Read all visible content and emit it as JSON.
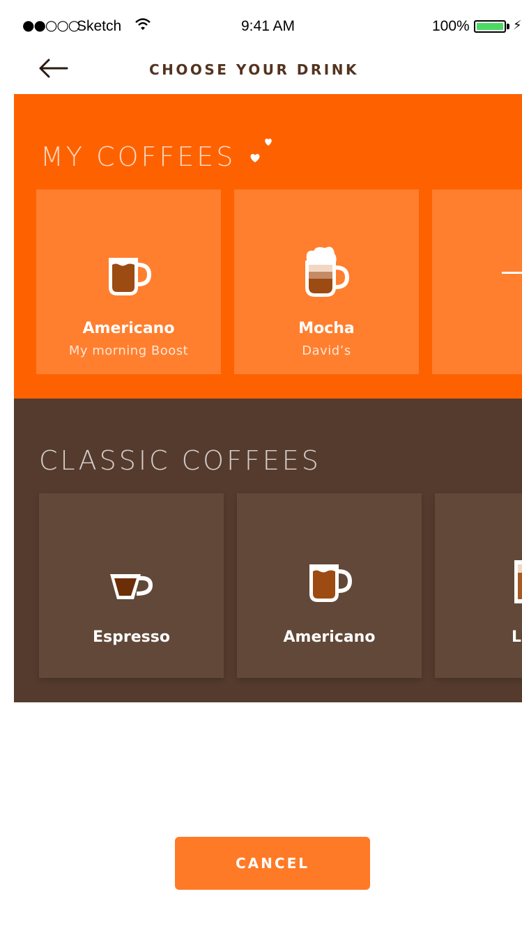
{
  "status_bar": {
    "signal": "●●○○○",
    "carrier": "Sketch",
    "time": "9:41 AM",
    "battery_percent": "100%"
  },
  "nav": {
    "title": "CHOOSE YOUR DRINK"
  },
  "my_coffees": {
    "title": "MY COFFEES",
    "cards": [
      {
        "name": "Americano",
        "subtitle": "My morning Boost",
        "icon": "americano-mug-icon"
      },
      {
        "name": "Mocha",
        "subtitle": "David’s",
        "icon": "mocha-mug-icon"
      }
    ]
  },
  "classic_coffees": {
    "title": "CLASSIC COFFEES",
    "cards": [
      {
        "name": "Espresso",
        "icon": "espresso-cup-icon"
      },
      {
        "name": "Americano",
        "icon": "americano-mug-icon"
      },
      {
        "name": "L",
        "icon": "latte-glass-icon"
      }
    ]
  },
  "cancel_label": "CANCEL",
  "colors": {
    "accent": "#fe6200",
    "brown": "#553b2e",
    "card_orange": "#ff7f2f",
    "card_brown": "#624838"
  }
}
